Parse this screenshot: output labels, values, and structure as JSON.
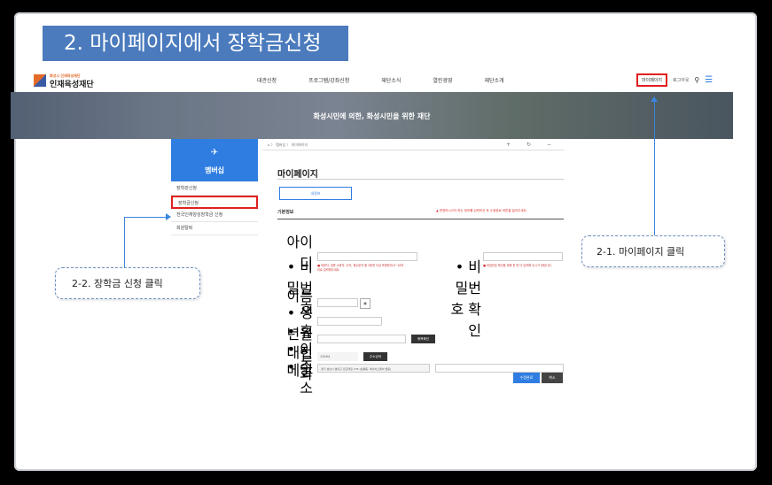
{
  "slide": {
    "title": "2. 마이페이지에서 장학금신청"
  },
  "site": {
    "logo_text": "인재육성재단",
    "logo_sub": "화성시 인재육성재단",
    "nav": [
      "대관신청",
      "프로그램/강좌신청",
      "재단소식",
      "열린경영",
      "재단소개"
    ],
    "util": {
      "mypage": "마이페이지",
      "logout": "로그아웃"
    },
    "banner_text": "화성시민에 의한, 화성시민을 위한 재단"
  },
  "lnb": {
    "title": "멤버십",
    "items": [
      "장학관신청",
      "장학금신청",
      "전국인재양성장학금 신청",
      "회원탈퇴"
    ]
  },
  "content": {
    "breadcrumb": "⌂ 〉 멤버십 〉 마이페이지",
    "tools": "+ ↻ −",
    "page_title": "마이페이지",
    "tab": "내정보",
    "section": "기본정보",
    "required_note": "▲ 변경하시고자 하는 정보를 입력하신 후 수정완료 버튼을 눌러주세요.",
    "labels": {
      "id": "아이디",
      "password": "• 비밀번호",
      "password_confirm": "• 비밀번호 확인",
      "name": "이름",
      "birth": "• 생년월일",
      "phone": "• 휴대전화",
      "email": "• 이메일",
      "address": "• 주소"
    },
    "help_pw": "■ 대문자, 영문 소문자, 숫자, 특수문자 중 3종류 이상 조합하여 8~16자리로 입력해주세요.",
    "help_pw2": "■ 비밀번호 확인을 위해 한 번 더 입력해 주시기 바랍니다.",
    "email_btn": "중복확인",
    "zip": "13494",
    "zip_btn": "주소검색",
    "address_value": "경기 성남시 분당구 판교역로 235 (삼평동, 에이치스퀘어 엔동)",
    "save_btn": "수정완료",
    "cancel_btn": "취소"
  },
  "callouts": {
    "step1": "2-1. 마이페이지 클릭",
    "step2": "2-2. 장학금 신청 클릭"
  },
  "colors": {
    "accent": "#2f7de1",
    "highlight": "#e02020",
    "title_bg": "#4b7bbd"
  }
}
